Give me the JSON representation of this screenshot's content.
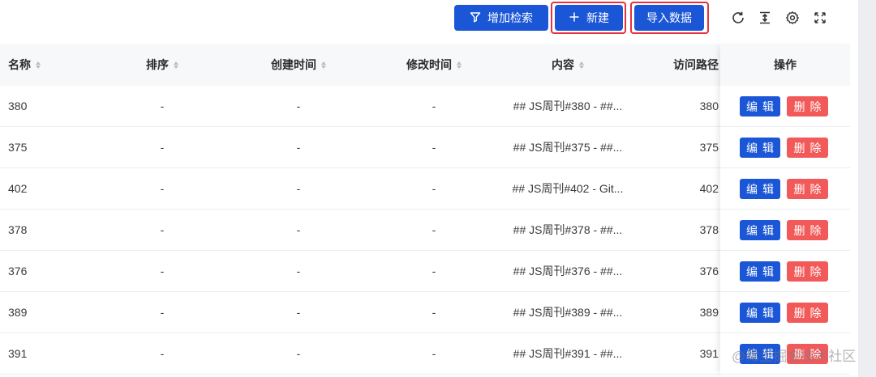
{
  "toolbar": {
    "search_label": "增加检索",
    "new_label": "新建",
    "import_label": "导入数据",
    "icons": [
      "filter-icon",
      "plus-icon",
      "refresh-icon",
      "density-icon",
      "settings-icon",
      "fullscreen-icon"
    ],
    "primary_color": "#1a56d6",
    "highlight_color": "#e8313a"
  },
  "table": {
    "columns": {
      "name": "名称",
      "sort": "排序",
      "created": "创建时间",
      "modified": "修改时间",
      "content": "内容",
      "path": "访问路径",
      "actions": "操作"
    },
    "rows": [
      {
        "name": "380",
        "sort": "-",
        "created": "-",
        "modified": "-",
        "content": "## JS周刊#380 - ##...",
        "path": "380"
      },
      {
        "name": "375",
        "sort": "-",
        "created": "-",
        "modified": "-",
        "content": "## JS周刊#375 - ##...",
        "path": "375"
      },
      {
        "name": "402",
        "sort": "-",
        "created": "-",
        "modified": "-",
        "content": "## JS周刊#402 - Git...",
        "path": "402"
      },
      {
        "name": "378",
        "sort": "-",
        "created": "-",
        "modified": "-",
        "content": "## JS周刊#378 - ##...",
        "path": "378"
      },
      {
        "name": "376",
        "sort": "-",
        "created": "-",
        "modified": "-",
        "content": "## JS周刊#376 - ##...",
        "path": "376"
      },
      {
        "name": "389",
        "sort": "-",
        "created": "-",
        "modified": "-",
        "content": "## JS周刊#389 - ##...",
        "path": "389"
      },
      {
        "name": "391",
        "sort": "-",
        "created": "-",
        "modified": "-",
        "content": "## JS周刊#391 - ##...",
        "path": "391"
      }
    ],
    "edit_label": "编辑",
    "delete_label": "删除",
    "delete_color": "#f25a5a"
  },
  "watermark": "@稀土掘金技术社区"
}
